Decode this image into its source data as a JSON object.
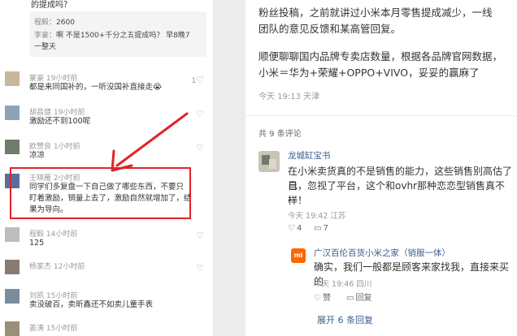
{
  "left_panel": {
    "top_text": "的提成吗？",
    "quote": {
      "line1_name": "程毅：",
      "line1_body": "2600",
      "line2_name": "李豪：",
      "line2_body": "啊 不是1500+千分之五提成吗？ 早8晚7",
      "line3_body": "一整天"
    },
    "comments": [
      {
        "name": "蒙豪 19小时前",
        "text": "都是来同国补的，一听没国补直接走😭",
        "likes": "1"
      },
      {
        "name": "胡昌健 19小时前",
        "text": "激励还不到100呢",
        "likes": ""
      },
      {
        "name": "欧赞良 1小时前",
        "text": "凉凉",
        "likes": ""
      },
      {
        "name": "王晓雁 2小时前",
        "lines": [
          "同学们多复盘一下自己做了哪些东西，不要只",
          "盯着激励，销量上去了，激励自然就增加了，结",
          "果为导向。"
        ],
        "likes": ""
      },
      {
        "name": "程毅 14小时前",
        "text": "125",
        "likes": ""
      },
      {
        "name": "杨家杰 12小时前",
        "text": "",
        "likes": ""
      },
      {
        "name": "刘凯 15小时前",
        "text": "卖没破百，卖昕鑫还不如卖儿童手表",
        "likes": ""
      },
      {
        "name": "姜涛 15小时前",
        "text": "",
        "likes": ""
      }
    ]
  },
  "right_panel": {
    "post_lines": [
      "粉丝投稿，之前就讲过小米本月零售提成减少，一线",
      "团队的意见反馈和某高管回复。",
      "",
      "顺便聊聊国内品牌专卖店数量，根据各品牌官网数据，",
      "小米＝华为+荣耀+OPPO+VIVO，妥妥的赢麻了"
    ],
    "post_meta": "今天 19:13 天津",
    "comment_count": "共 9 条评论",
    "top_comment": {
      "name": "龙城缸宝书",
      "lines": [
        "在小米卖货真的不是销售的能力，这些销售别高估了自",
        "己，忽视了平台，这个和ovhr那种恋恋型销售真不一",
        "样！"
      ],
      "meta": "今天 19:42 江苏",
      "likes": "4",
      "replies": "7"
    },
    "reply": {
      "name": "广汉百伦百货小米之家（销服一体）",
      "logo_text": "mi",
      "text": "确实，我们一般都是顾客来家找我，直接来买的",
      "meta": "今天 19:46 四川",
      "like_label": "赞",
      "reply_label": "回复"
    },
    "expand_label": "展开 6 条回复"
  },
  "colors": {
    "highlight": "#e3222a",
    "link": "#3a5f90",
    "mi_orange": "#ff6700"
  }
}
